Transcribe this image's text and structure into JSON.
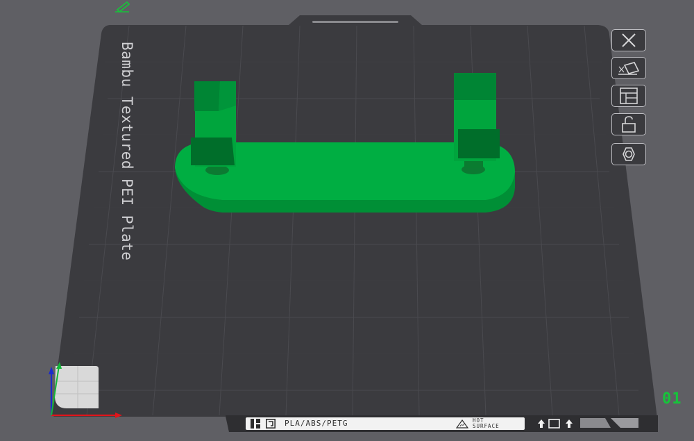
{
  "plate": {
    "name": "Bambu Textured PEI Plate",
    "number": "01",
    "material_label": "PLA/ABS/PETG",
    "warning_line1": "HOT",
    "warning_line2": "SURFACE"
  },
  "toolbar": {
    "items": [
      {
        "name": "close-plate-button",
        "icon": "close-icon"
      },
      {
        "name": "auto-orient-button",
        "icon": "auto-orient-icon"
      },
      {
        "name": "arrange-button",
        "icon": "arrange-icon"
      },
      {
        "name": "lock-plate-button",
        "icon": "lock-icon"
      },
      {
        "name": "plate-settings-button",
        "icon": "settings-icon"
      }
    ]
  },
  "colors": {
    "background": "#5f5f64",
    "plate": "#3b3b3f",
    "grid": "#4a4a4f",
    "model": "#00ae42",
    "number": "#16c43a"
  }
}
